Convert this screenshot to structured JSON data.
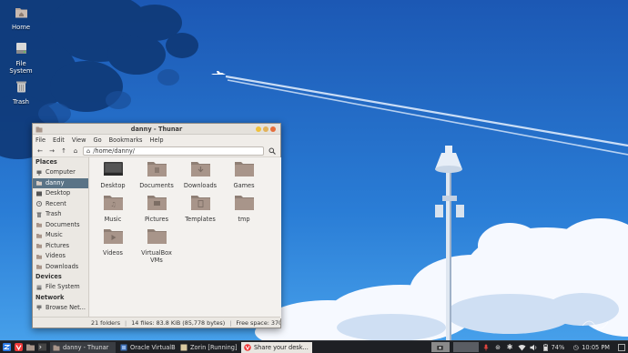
{
  "desktop": {
    "icons": [
      {
        "label": "Home"
      },
      {
        "label": "File System"
      },
      {
        "label": "Trash"
      }
    ]
  },
  "window": {
    "title": "danny - Thunar",
    "menu": [
      "File",
      "Edit",
      "View",
      "Go",
      "Bookmarks",
      "Help"
    ],
    "path": "/home/danny/",
    "sidebar": {
      "places_header": "Places",
      "places": [
        "Computer",
        "danny",
        "Desktop",
        "Recent",
        "Trash",
        "Documents",
        "Music",
        "Pictures",
        "Videos",
        "Downloads"
      ],
      "devices_header": "Devices",
      "devices": [
        "File System"
      ],
      "network_header": "Network",
      "network": [
        "Browse Net..."
      ]
    },
    "files": [
      {
        "name": "Desktop"
      },
      {
        "name": "Documents"
      },
      {
        "name": "Downloads"
      },
      {
        "name": "Games"
      },
      {
        "name": "Music"
      },
      {
        "name": "Pictures"
      },
      {
        "name": "Templates"
      },
      {
        "name": "tmp"
      },
      {
        "name": "Videos"
      },
      {
        "name": "VirtualBox VMs"
      }
    ],
    "status": {
      "folders": "21 folders",
      "files": "14 files: 83.8 KiB (85,778 bytes)",
      "free": "Free space: 370..."
    }
  },
  "taskbar": {
    "tasks": [
      {
        "label": "danny - Thunar"
      },
      {
        "label": "Oracle VirtualBo..."
      },
      {
        "label": "Zorin [Running] ..."
      },
      {
        "label": "Share your desk..."
      }
    ],
    "battery": "74%",
    "clock": "10:05 PM"
  },
  "colors": {
    "sky_top": "#1d5fb8",
    "sky_bottom": "#2f8fe0",
    "selection": "#5a7386",
    "folder": "#a8958a",
    "taskbar": "#1e2024"
  }
}
